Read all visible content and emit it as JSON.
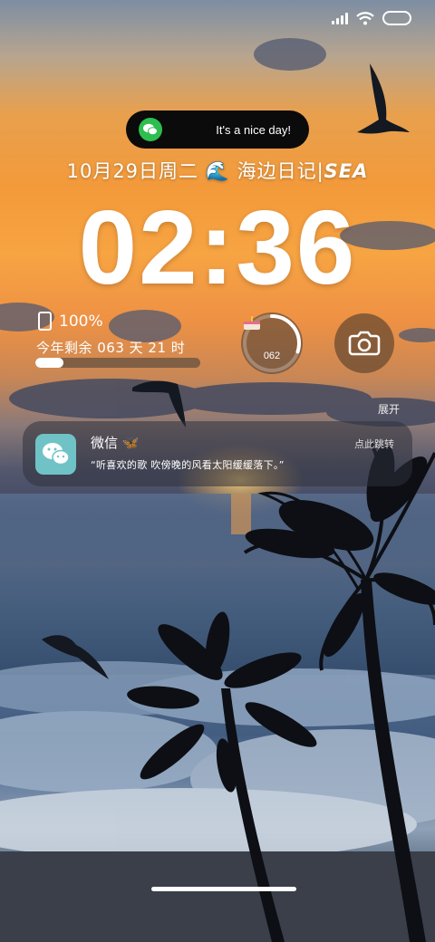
{
  "island": {
    "text": "It's a nice day!",
    "icon": "wechat-icon"
  },
  "lockscreen": {
    "date": "10月29日周二",
    "journal": "海边日记",
    "tag": "SEA",
    "wave_emoji": "🌊",
    "time": "02:36"
  },
  "info_widget": {
    "battery": "100%",
    "year_remaining": "今年剩余 063 天  21 时",
    "year_progress": 0.17
  },
  "ring_widget": {
    "value": "062",
    "progress": 0.3,
    "icon": "cake-icon"
  },
  "camera": {
    "icon": "camera-icon"
  },
  "expand_label": "展开",
  "notification": {
    "app": "微信",
    "emoji": "🦋",
    "action": "点此跳转",
    "message": "“听喜欢的歌 吹傍晚的风看太阳缓缓落下。”",
    "icon": "wechat-icon"
  },
  "colors": {
    "wechat_green": "#2dbe4f",
    "wechat_tile": "#6fc3c6"
  }
}
